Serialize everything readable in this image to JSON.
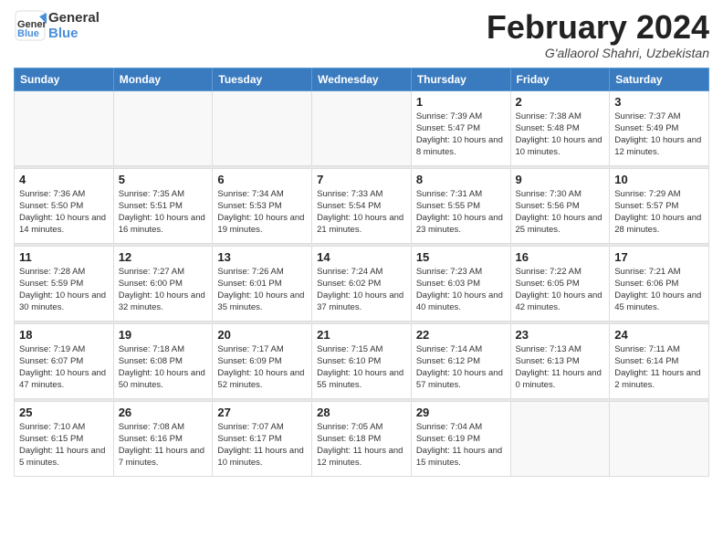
{
  "header": {
    "logo_line1": "General",
    "logo_line2": "Blue",
    "month_title": "February 2024",
    "subtitle": "G'allaorol Shahri, Uzbekistan"
  },
  "weekdays": [
    "Sunday",
    "Monday",
    "Tuesday",
    "Wednesday",
    "Thursday",
    "Friday",
    "Saturday"
  ],
  "weeks": [
    [
      {
        "day": "",
        "info": ""
      },
      {
        "day": "",
        "info": ""
      },
      {
        "day": "",
        "info": ""
      },
      {
        "day": "",
        "info": ""
      },
      {
        "day": "1",
        "info": "Sunrise: 7:39 AM\nSunset: 5:47 PM\nDaylight: 10 hours\nand 8 minutes."
      },
      {
        "day": "2",
        "info": "Sunrise: 7:38 AM\nSunset: 5:48 PM\nDaylight: 10 hours\nand 10 minutes."
      },
      {
        "day": "3",
        "info": "Sunrise: 7:37 AM\nSunset: 5:49 PM\nDaylight: 10 hours\nand 12 minutes."
      }
    ],
    [
      {
        "day": "4",
        "info": "Sunrise: 7:36 AM\nSunset: 5:50 PM\nDaylight: 10 hours\nand 14 minutes."
      },
      {
        "day": "5",
        "info": "Sunrise: 7:35 AM\nSunset: 5:51 PM\nDaylight: 10 hours\nand 16 minutes."
      },
      {
        "day": "6",
        "info": "Sunrise: 7:34 AM\nSunset: 5:53 PM\nDaylight: 10 hours\nand 19 minutes."
      },
      {
        "day": "7",
        "info": "Sunrise: 7:33 AM\nSunset: 5:54 PM\nDaylight: 10 hours\nand 21 minutes."
      },
      {
        "day": "8",
        "info": "Sunrise: 7:31 AM\nSunset: 5:55 PM\nDaylight: 10 hours\nand 23 minutes."
      },
      {
        "day": "9",
        "info": "Sunrise: 7:30 AM\nSunset: 5:56 PM\nDaylight: 10 hours\nand 25 minutes."
      },
      {
        "day": "10",
        "info": "Sunrise: 7:29 AM\nSunset: 5:57 PM\nDaylight: 10 hours\nand 28 minutes."
      }
    ],
    [
      {
        "day": "11",
        "info": "Sunrise: 7:28 AM\nSunset: 5:59 PM\nDaylight: 10 hours\nand 30 minutes."
      },
      {
        "day": "12",
        "info": "Sunrise: 7:27 AM\nSunset: 6:00 PM\nDaylight: 10 hours\nand 32 minutes."
      },
      {
        "day": "13",
        "info": "Sunrise: 7:26 AM\nSunset: 6:01 PM\nDaylight: 10 hours\nand 35 minutes."
      },
      {
        "day": "14",
        "info": "Sunrise: 7:24 AM\nSunset: 6:02 PM\nDaylight: 10 hours\nand 37 minutes."
      },
      {
        "day": "15",
        "info": "Sunrise: 7:23 AM\nSunset: 6:03 PM\nDaylight: 10 hours\nand 40 minutes."
      },
      {
        "day": "16",
        "info": "Sunrise: 7:22 AM\nSunset: 6:05 PM\nDaylight: 10 hours\nand 42 minutes."
      },
      {
        "day": "17",
        "info": "Sunrise: 7:21 AM\nSunset: 6:06 PM\nDaylight: 10 hours\nand 45 minutes."
      }
    ],
    [
      {
        "day": "18",
        "info": "Sunrise: 7:19 AM\nSunset: 6:07 PM\nDaylight: 10 hours\nand 47 minutes."
      },
      {
        "day": "19",
        "info": "Sunrise: 7:18 AM\nSunset: 6:08 PM\nDaylight: 10 hours\nand 50 minutes."
      },
      {
        "day": "20",
        "info": "Sunrise: 7:17 AM\nSunset: 6:09 PM\nDaylight: 10 hours\nand 52 minutes."
      },
      {
        "day": "21",
        "info": "Sunrise: 7:15 AM\nSunset: 6:10 PM\nDaylight: 10 hours\nand 55 minutes."
      },
      {
        "day": "22",
        "info": "Sunrise: 7:14 AM\nSunset: 6:12 PM\nDaylight: 10 hours\nand 57 minutes."
      },
      {
        "day": "23",
        "info": "Sunrise: 7:13 AM\nSunset: 6:13 PM\nDaylight: 11 hours\nand 0 minutes."
      },
      {
        "day": "24",
        "info": "Sunrise: 7:11 AM\nSunset: 6:14 PM\nDaylight: 11 hours\nand 2 minutes."
      }
    ],
    [
      {
        "day": "25",
        "info": "Sunrise: 7:10 AM\nSunset: 6:15 PM\nDaylight: 11 hours\nand 5 minutes."
      },
      {
        "day": "26",
        "info": "Sunrise: 7:08 AM\nSunset: 6:16 PM\nDaylight: 11 hours\nand 7 minutes."
      },
      {
        "day": "27",
        "info": "Sunrise: 7:07 AM\nSunset: 6:17 PM\nDaylight: 11 hours\nand 10 minutes."
      },
      {
        "day": "28",
        "info": "Sunrise: 7:05 AM\nSunset: 6:18 PM\nDaylight: 11 hours\nand 12 minutes."
      },
      {
        "day": "29",
        "info": "Sunrise: 7:04 AM\nSunset: 6:19 PM\nDaylight: 11 hours\nand 15 minutes."
      },
      {
        "day": "",
        "info": ""
      },
      {
        "day": "",
        "info": ""
      }
    ]
  ]
}
